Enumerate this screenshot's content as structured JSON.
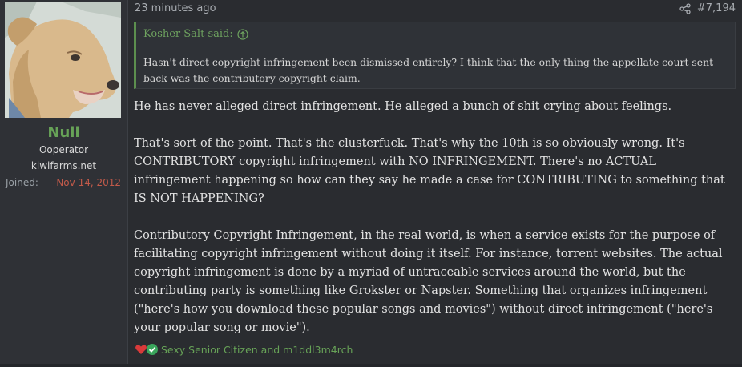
{
  "user": {
    "name": "Null",
    "title": "Ooperator",
    "site": "kiwifarms.net",
    "joined_label": "Joined:",
    "joined_date": "Nov 14, 2012",
    "avatar": "dog-avatar"
  },
  "meta": {
    "time": "23 minutes ago",
    "post_number": "#7,194",
    "share_icon": "share-icon"
  },
  "quote": {
    "author_label": "Kosher Salt said:",
    "jump_icon": "arrow-up-circle-icon",
    "text": "Hasn't direct copyright infringement been dismissed entirely? I think that the only thing the appellate court sent back was the contributory copyright claim."
  },
  "body": {
    "p1": "He has never alleged direct infringement. He alleged a bunch of shit crying about feelings.",
    "p2": "That's sort of the point. That's the clusterfuck. That's why the 10th is so obviously wrong. It's CONTRIBUTORY copyright infringement with NO INFRINGEMENT. There's no ACTUAL infringement happening so how can they say he made a case for CONTRIBUTING to something that IS NOT HAPPENING?",
    "p3": "Contributory Copyright Infringement, in the real world, is when a service exists for the purpose of facilitating copyright infringement without doing it itself. For instance, torrent websites. The actual copyright infringement is done by a myriad of untraceable services around the world, but the contributing party is something like Grokster or Napster. Something that organizes infringement (\"here's how you download these popular songs and movies\") without direct infringement (\"here's your popular song or movie\")."
  },
  "reactions": {
    "icons": [
      "heart-icon",
      "check-icon"
    ],
    "names": "Sexy Senior Citizen and m1ddl3m4rch"
  },
  "colors": {
    "accent_green": "#67a257",
    "joined_date_red": "#c25a4a",
    "background": "#2a2c30"
  }
}
